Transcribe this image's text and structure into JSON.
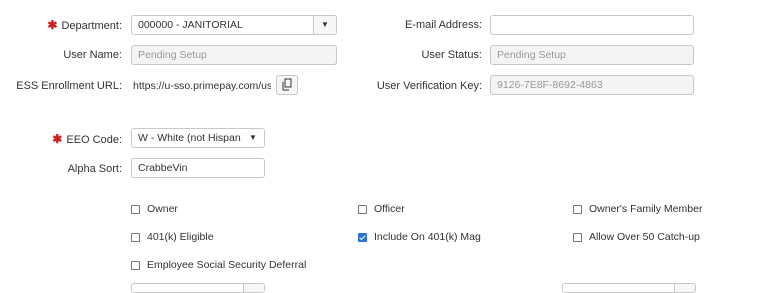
{
  "fields": {
    "department": {
      "label": "Department:",
      "value": "000000 - JANITORIAL",
      "required": true
    },
    "email": {
      "label": "E-mail Address:",
      "value": ""
    },
    "user_name": {
      "label": "User Name:",
      "placeholder": "Pending Setup"
    },
    "user_status": {
      "label": "User Status:",
      "placeholder": "Pending Setup"
    },
    "ess_url": {
      "label": "ESS Enrollment URL:",
      "value": "https://u-sso.primepay.com/use"
    },
    "verification_key": {
      "label": "User Verification Key:",
      "value": "9126-7E8F-8692-4863"
    },
    "eeo_code": {
      "label": "EEO Code:",
      "value": "W - White (not Hispan...",
      "required": true
    },
    "alpha_sort": {
      "label": "Alpha Sort:",
      "value": "CrabbeVin"
    }
  },
  "checkboxes": [
    {
      "label": "Owner",
      "checked": false
    },
    {
      "label": "Officer",
      "checked": false
    },
    {
      "label": "Owner's Family Member",
      "checked": false
    },
    {
      "label": "401(k) Eligible",
      "checked": false
    },
    {
      "label": "Include On 401(k) Mag",
      "checked": true
    },
    {
      "label": "Allow Over 50 Catch-up",
      "checked": false
    },
    {
      "label": "Employee Social Security Deferral",
      "checked": false
    }
  ],
  "icons": {
    "required": "asterisk",
    "copy": "copy-icon",
    "dropdown": "caret-down-icon"
  },
  "colors": {
    "required": "#cc1f1f",
    "checked": "#2e72d6"
  }
}
